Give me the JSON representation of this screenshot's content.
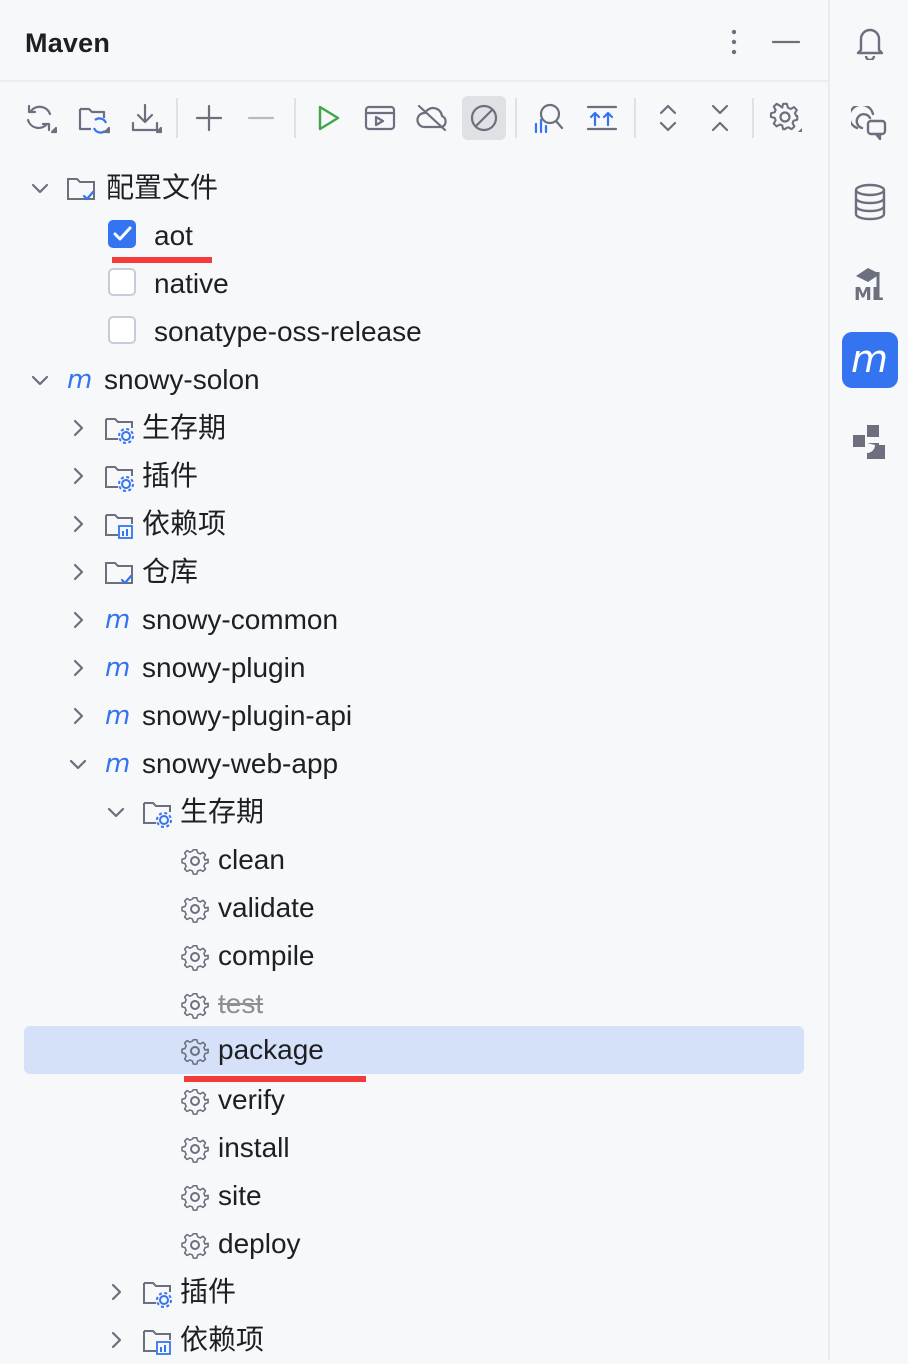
{
  "header": {
    "title": "Maven"
  },
  "colors": {
    "accent": "#3574f0",
    "selection": "#d5e1f9",
    "highlight": "#f43b3b",
    "icon": "#6c707e",
    "run": "#3fa64a"
  },
  "toolbar": {
    "icons": [
      "reload-all-icon",
      "reload-project-icon",
      "download-icon",
      "add-icon",
      "remove-icon",
      "run-icon",
      "execute-goal-icon",
      "offline-icon",
      "skip-tests-icon",
      "analyze-dependencies-icon",
      "show-dependencies-icon",
      "expand-all-icon",
      "collapse-all-icon",
      "settings-icon"
    ]
  },
  "tree": {
    "profiles": {
      "label": "配置文件",
      "items": [
        {
          "label": "aot",
          "checked": true
        },
        {
          "label": "native",
          "checked": false
        },
        {
          "label": "sonatype-oss-release",
          "checked": false
        }
      ]
    },
    "root": {
      "label": "snowy-solon",
      "children": [
        {
          "label": "生存期"
        },
        {
          "label": "插件"
        },
        {
          "label": "依赖项"
        },
        {
          "label": "仓库"
        }
      ],
      "modules": [
        "snowy-common",
        "snowy-plugin",
        "snowy-plugin-api"
      ]
    },
    "webapp": {
      "label": "snowy-web-app",
      "lifecycle": "生存期",
      "goals": [
        "clean",
        "validate",
        "compile",
        "test",
        "package",
        "verify",
        "install",
        "site",
        "deploy"
      ],
      "skipped_goal": "test",
      "selected_goal": "package",
      "plugins": "插件",
      "dependencies": "依赖项"
    }
  },
  "rightbar": {
    "icons": [
      "notifications-icon",
      "ai-chat-icon",
      "database-icon",
      "ml-icon",
      "maven-icon",
      "plugin-icon"
    ],
    "active": "maven-icon"
  }
}
